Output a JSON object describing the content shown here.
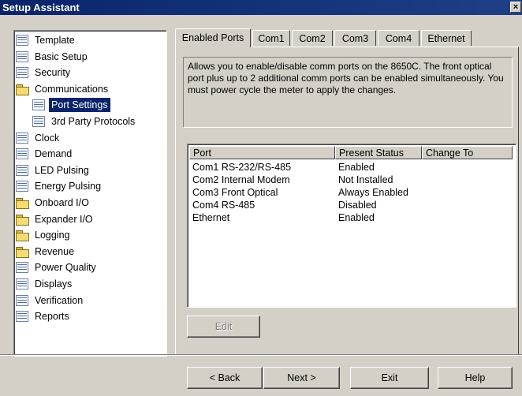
{
  "window": {
    "title": "Setup Assistant",
    "close_glyph": "×"
  },
  "tree": {
    "items": [
      {
        "label": "Template",
        "icon": "doc-icon"
      },
      {
        "label": "Basic Setup",
        "icon": "doc-icon"
      },
      {
        "label": "Security",
        "icon": "doc-icon"
      },
      {
        "label": "Communications",
        "icon": "folder-open-icon"
      },
      {
        "label": "Port Settings",
        "icon": "doc-icon",
        "selected": true
      },
      {
        "label": "3rd Party Protocols",
        "icon": "doc-icon"
      },
      {
        "label": "Clock",
        "icon": "doc-icon"
      },
      {
        "label": "Demand",
        "icon": "doc-icon"
      },
      {
        "label": "LED Pulsing",
        "icon": "doc-icon"
      },
      {
        "label": "Energy Pulsing",
        "icon": "doc-icon"
      },
      {
        "label": "Onboard I/O",
        "icon": "folder-icon"
      },
      {
        "label": "Expander I/O",
        "icon": "folder-icon"
      },
      {
        "label": "Logging",
        "icon": "folder-icon"
      },
      {
        "label": "Revenue",
        "icon": "folder-icon"
      },
      {
        "label": "Power Quality",
        "icon": "doc-icon"
      },
      {
        "label": "Displays",
        "icon": "doc-icon"
      },
      {
        "label": "Verification",
        "icon": "doc-icon"
      },
      {
        "label": "Reports",
        "icon": "doc-icon"
      }
    ]
  },
  "tabs": [
    "Enabled Ports",
    "Com1",
    "Com2",
    "Com3",
    "Com4",
    "Ethernet"
  ],
  "description": "Allows you to enable/disable comm ports on the 8650C.  The front optical port plus up to 2 additional comm ports can be enabled simultaneously.  You must power cycle the meter to apply the changes.",
  "ports_table": {
    "columns": [
      "Port",
      "Present Status",
      "Change To"
    ],
    "rows": [
      {
        "port": "Com1 RS-232/RS-485",
        "status": "Enabled",
        "change": ""
      },
      {
        "port": "Com2 Internal Modem",
        "status": "Not Installed",
        "change": ""
      },
      {
        "port": "Com3 Front Optical",
        "status": "Always Enabled",
        "change": ""
      },
      {
        "port": "Com4 RS-485",
        "status": "Disabled",
        "change": ""
      },
      {
        "port": "Ethernet",
        "status": "Enabled",
        "change": ""
      }
    ]
  },
  "buttons": {
    "edit": "Edit",
    "back": "< Back",
    "next": "Next >",
    "exit": "Exit",
    "help": "Help"
  }
}
